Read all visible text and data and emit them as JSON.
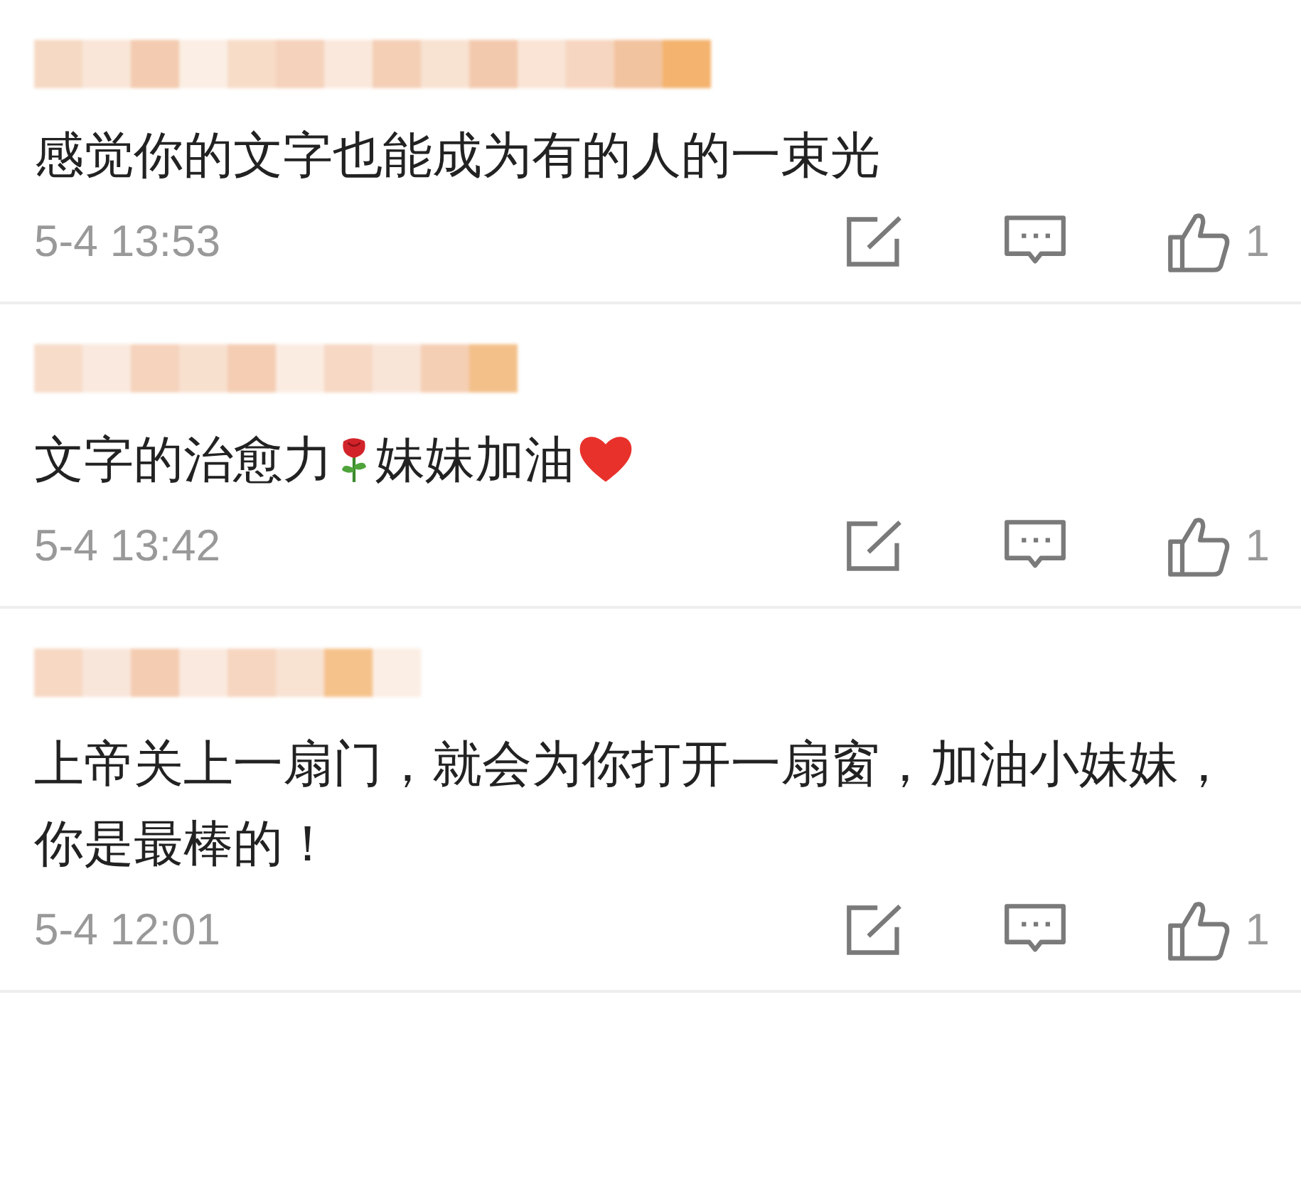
{
  "comments": [
    {
      "content": [
        {
          "kind": "text",
          "text": "感觉你的文字也能成为有的人的一束光"
        }
      ],
      "time": "5-4 13:53",
      "likes": "1"
    },
    {
      "content": [
        {
          "kind": "text",
          "text": "文字的治愈力"
        },
        {
          "kind": "rose"
        },
        {
          "kind": "text",
          "text": "妹妹加油"
        },
        {
          "kind": "heart"
        }
      ],
      "time": "5-4 13:42",
      "likes": "1"
    },
    {
      "content": [
        {
          "kind": "text",
          "text": "上帝关上一扇门，就会为你打开一扇窗，加油小妹妹，你是最棒的！"
        }
      ],
      "time": "5-4 12:01",
      "likes": "1"
    }
  ]
}
